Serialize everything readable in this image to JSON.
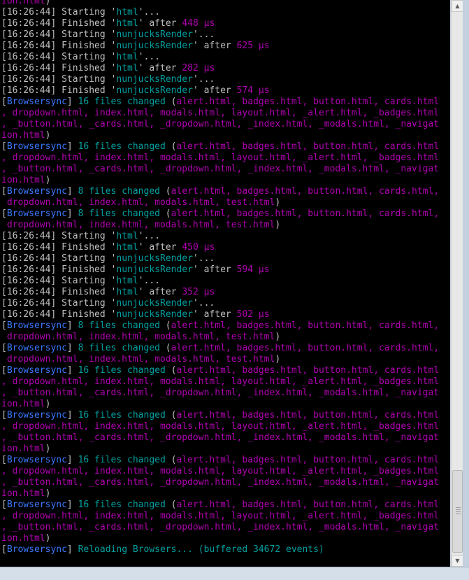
{
  "console": {
    "lines": [
      [
        [
          "ion.html",
          "mag"
        ],
        [
          ")",
          "gray"
        ]
      ],
      [
        [
          "[16:26:44] Starting '",
          "gray"
        ],
        [
          "html",
          "cyan"
        ],
        [
          "'...",
          "gray"
        ]
      ],
      [
        [
          "[16:26:44] Finished '",
          "gray"
        ],
        [
          "html",
          "cyan"
        ],
        [
          "' after ",
          "gray"
        ],
        [
          "448 μs",
          "mag"
        ]
      ],
      [
        [
          "[16:26:44] Starting '",
          "gray"
        ],
        [
          "nunjucksRender",
          "cyan"
        ],
        [
          "'...",
          "gray"
        ]
      ],
      [
        [
          "[16:26:44] Finished '",
          "gray"
        ],
        [
          "nunjucksRender",
          "cyan"
        ],
        [
          "' after ",
          "gray"
        ],
        [
          "625 μs",
          "mag"
        ]
      ],
      [
        [
          "[16:26:44] Starting '",
          "gray"
        ],
        [
          "html",
          "cyan"
        ],
        [
          "'...",
          "gray"
        ]
      ],
      [
        [
          "[16:26:44] Finished '",
          "gray"
        ],
        [
          "html",
          "cyan"
        ],
        [
          "' after ",
          "gray"
        ],
        [
          "282 μs",
          "mag"
        ]
      ],
      [
        [
          "[16:26:44] Starting '",
          "gray"
        ],
        [
          "nunjucksRender",
          "cyan"
        ],
        [
          "'...",
          "gray"
        ]
      ],
      [
        [
          "[16:26:44] Finished '",
          "gray"
        ],
        [
          "nunjucksRender",
          "cyan"
        ],
        [
          "' after ",
          "gray"
        ],
        [
          "574 μs",
          "mag"
        ]
      ],
      [
        [
          "[",
          "gray"
        ],
        [
          "Browsersync",
          "blue"
        ],
        [
          "] ",
          "gray"
        ],
        [
          "16 files changed",
          "cyan"
        ],
        [
          " (",
          "gray"
        ],
        [
          "alert.html, badges.html, button.html, cards.html",
          "mag"
        ]
      ],
      [
        [
          ", dropdown.html, index.html, modals.html, layout.html, _alert.html, _badges.html",
          "mag"
        ]
      ],
      [
        [
          ", _button.html, _cards.html, _dropdown.html, _index.html, _modals.html, _navigat",
          "mag"
        ]
      ],
      [
        [
          "ion.html",
          "mag"
        ],
        [
          ")",
          "gray"
        ]
      ],
      [
        [
          "[",
          "gray"
        ],
        [
          "Browsersync",
          "blue"
        ],
        [
          "] ",
          "gray"
        ],
        [
          "16 files changed",
          "cyan"
        ],
        [
          " (",
          "gray"
        ],
        [
          "alert.html, badges.html, button.html, cards.html",
          "mag"
        ]
      ],
      [
        [
          ", dropdown.html, index.html, modals.html, layout.html, _alert.html, _badges.html",
          "mag"
        ]
      ],
      [
        [
          ", _button.html, _cards.html, _dropdown.html, _index.html, _modals.html, _navigat",
          "mag"
        ]
      ],
      [
        [
          "ion.html",
          "mag"
        ],
        [
          ")",
          "gray"
        ]
      ],
      [
        [
          "[",
          "gray"
        ],
        [
          "Browsersync",
          "blue"
        ],
        [
          "] ",
          "gray"
        ],
        [
          "8 files changed",
          "cyan"
        ],
        [
          " (",
          "gray"
        ],
        [
          "alert.html, badges.html, button.html, cards.html,",
          "mag"
        ]
      ],
      [
        [
          " dropdown.html, index.html, modals.html, test.html",
          "mag"
        ],
        [
          ")",
          "gray"
        ]
      ],
      [
        [
          "[",
          "gray"
        ],
        [
          "Browsersync",
          "blue"
        ],
        [
          "] ",
          "gray"
        ],
        [
          "8 files changed",
          "cyan"
        ],
        [
          " (",
          "gray"
        ],
        [
          "alert.html, badges.html, button.html, cards.html,",
          "mag"
        ]
      ],
      [
        [
          " dropdown.html, index.html, modals.html, test.html",
          "mag"
        ],
        [
          ")",
          "gray"
        ]
      ],
      [
        [
          "[16:26:44] Starting '",
          "gray"
        ],
        [
          "html",
          "cyan"
        ],
        [
          "'...",
          "gray"
        ]
      ],
      [
        [
          "[16:26:44] Finished '",
          "gray"
        ],
        [
          "html",
          "cyan"
        ],
        [
          "' after ",
          "gray"
        ],
        [
          "450 μs",
          "mag"
        ]
      ],
      [
        [
          "[16:26:44] Starting '",
          "gray"
        ],
        [
          "nunjucksRender",
          "cyan"
        ],
        [
          "'...",
          "gray"
        ]
      ],
      [
        [
          "[16:26:44] Finished '",
          "gray"
        ],
        [
          "nunjucksRender",
          "cyan"
        ],
        [
          "' after ",
          "gray"
        ],
        [
          "594 μs",
          "mag"
        ]
      ],
      [
        [
          "[16:26:44] Starting '",
          "gray"
        ],
        [
          "html",
          "cyan"
        ],
        [
          "'...",
          "gray"
        ]
      ],
      [
        [
          "[16:26:44] Finished '",
          "gray"
        ],
        [
          "html",
          "cyan"
        ],
        [
          "' after ",
          "gray"
        ],
        [
          "352 μs",
          "mag"
        ]
      ],
      [
        [
          "[16:26:44] Starting '",
          "gray"
        ],
        [
          "nunjucksRender",
          "cyan"
        ],
        [
          "'...",
          "gray"
        ]
      ],
      [
        [
          "[16:26:44] Finished '",
          "gray"
        ],
        [
          "nunjucksRender",
          "cyan"
        ],
        [
          "' after ",
          "gray"
        ],
        [
          "502 μs",
          "mag"
        ]
      ],
      [
        [
          "[",
          "gray"
        ],
        [
          "Browsersync",
          "blue"
        ],
        [
          "] ",
          "gray"
        ],
        [
          "8 files changed",
          "cyan"
        ],
        [
          " (",
          "gray"
        ],
        [
          "alert.html, badges.html, button.html, cards.html,",
          "mag"
        ]
      ],
      [
        [
          " dropdown.html, index.html, modals.html, test.html",
          "mag"
        ],
        [
          ")",
          "gray"
        ]
      ],
      [
        [
          "[",
          "gray"
        ],
        [
          "Browsersync",
          "blue"
        ],
        [
          "] ",
          "gray"
        ],
        [
          "8 files changed",
          "cyan"
        ],
        [
          " (",
          "gray"
        ],
        [
          "alert.html, badges.html, button.html, cards.html,",
          "mag"
        ]
      ],
      [
        [
          " dropdown.html, index.html, modals.html, test.html",
          "mag"
        ],
        [
          ")",
          "gray"
        ]
      ],
      [
        [
          "[",
          "gray"
        ],
        [
          "Browsersync",
          "blue"
        ],
        [
          "] ",
          "gray"
        ],
        [
          "16 files changed",
          "cyan"
        ],
        [
          " (",
          "gray"
        ],
        [
          "alert.html, badges.html, button.html, cards.html",
          "mag"
        ]
      ],
      [
        [
          ", dropdown.html, index.html, modals.html, layout.html, _alert.html, _badges.html",
          "mag"
        ]
      ],
      [
        [
          ", _button.html, _cards.html, _dropdown.html, _index.html, _modals.html, _navigat",
          "mag"
        ]
      ],
      [
        [
          "ion.html",
          "mag"
        ],
        [
          ")",
          "gray"
        ]
      ],
      [
        [
          "[",
          "gray"
        ],
        [
          "Browsersync",
          "blue"
        ],
        [
          "] ",
          "gray"
        ],
        [
          "16 files changed",
          "cyan"
        ],
        [
          " (",
          "gray"
        ],
        [
          "alert.html, badges.html, button.html, cards.html",
          "mag"
        ]
      ],
      [
        [
          ", dropdown.html, index.html, modals.html, layout.html, _alert.html, _badges.html",
          "mag"
        ]
      ],
      [
        [
          ", _button.html, _cards.html, _dropdown.html, _index.html, _modals.html, _navigat",
          "mag"
        ]
      ],
      [
        [
          "ion.html",
          "mag"
        ],
        [
          ")",
          "gray"
        ]
      ],
      [
        [
          "[",
          "gray"
        ],
        [
          "Browsersync",
          "blue"
        ],
        [
          "] ",
          "gray"
        ],
        [
          "16 files changed",
          "cyan"
        ],
        [
          " (",
          "gray"
        ],
        [
          "alert.html, badges.html, button.html, cards.html",
          "mag"
        ]
      ],
      [
        [
          ", dropdown.html, index.html, modals.html, layout.html, _alert.html, _badges.html",
          "mag"
        ]
      ],
      [
        [
          ", _button.html, _cards.html, _dropdown.html, _index.html, _modals.html, _navigat",
          "mag"
        ]
      ],
      [
        [
          "ion.html",
          "mag"
        ],
        [
          ")",
          "gray"
        ]
      ],
      [
        [
          "[",
          "gray"
        ],
        [
          "Browsersync",
          "blue"
        ],
        [
          "] ",
          "gray"
        ],
        [
          "16 files changed",
          "cyan"
        ],
        [
          " (",
          "gray"
        ],
        [
          "alert.html, badges.html, button.html, cards.html",
          "mag"
        ]
      ],
      [
        [
          ", dropdown.html, index.html, modals.html, layout.html, _alert.html, _badges.html",
          "mag"
        ]
      ],
      [
        [
          ", _button.html, _cards.html, _dropdown.html, _index.html, _modals.html, _navigat",
          "mag"
        ]
      ],
      [
        [
          "ion.html",
          "mag"
        ],
        [
          ")",
          "gray"
        ]
      ],
      [
        [
          "[",
          "gray"
        ],
        [
          "Browsersync",
          "blue"
        ],
        [
          "] ",
          "gray"
        ],
        [
          "Reloading Browsers... (buffered 34672 events)",
          "cyan"
        ]
      ]
    ]
  },
  "colors": {
    "gray": "#c0c0c0",
    "mag": "#b000b0",
    "cyan": "#00a0a0",
    "blue": "#3a78ff"
  },
  "scrollbar": {
    "up_icon": "chevron-up-icon",
    "down_icon": "chevron-down-icon",
    "up_glyph": "▲",
    "down_glyph": "▼"
  }
}
